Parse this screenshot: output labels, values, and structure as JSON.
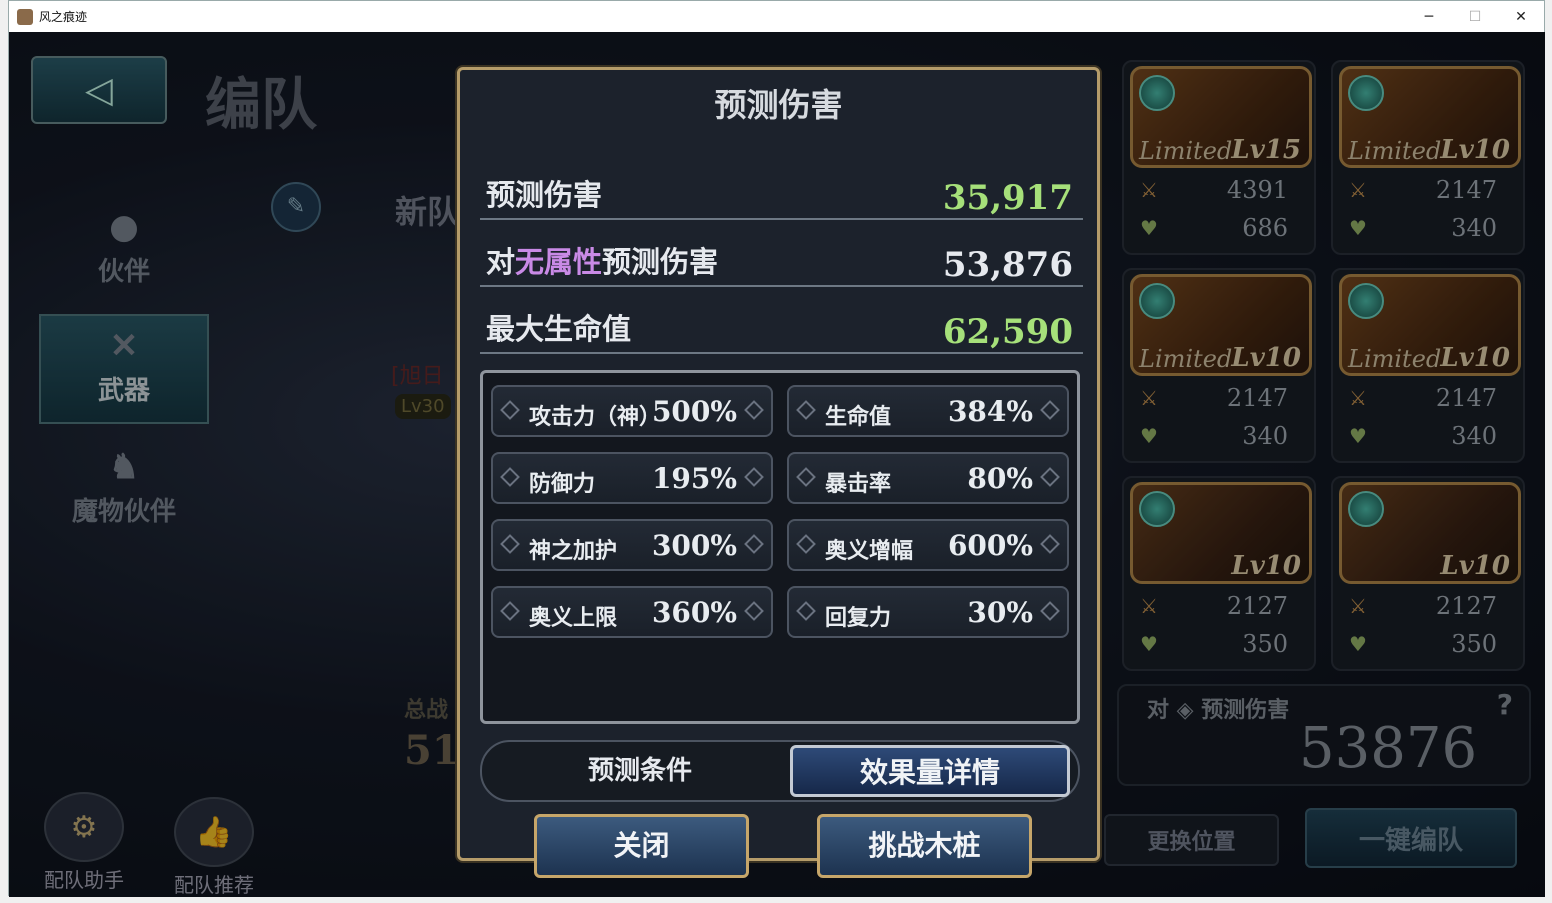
{
  "window": {
    "title": "风之痕迹"
  },
  "left": {
    "formation_title": "编队",
    "menu": [
      {
        "label": "伙伴",
        "icon": "person-icon"
      },
      {
        "label": "武器",
        "icon": "crossed-swords-icon"
      },
      {
        "label": "魔物伙伴",
        "icon": "dragon-icon"
      }
    ],
    "team_new": "新队",
    "team_sub1": "[旭日",
    "team_sub2": "Lv30",
    "total_label": "总战",
    "total_val": "51",
    "tools": [
      {
        "label": "配队助手",
        "icon": "gear-icon"
      },
      {
        "label": "配队推荐",
        "icon": "thumbs-up-icon"
      }
    ]
  },
  "modal": {
    "title": "预测伤害",
    "metrics": [
      {
        "label": "预测伤害",
        "value": "35,917",
        "value_color": "green"
      },
      {
        "label_prefix": "对",
        "label_highlight": "无属性",
        "label_suffix": "预测伤害",
        "value": "53,876",
        "value_color": "white"
      },
      {
        "label": "最大生命值",
        "value": "62,590",
        "value_color": "green"
      }
    ],
    "stats": [
      {
        "label": "攻击力（神）",
        "value": "500%"
      },
      {
        "label": "生命值",
        "value": "384%"
      },
      {
        "label": "防御力",
        "value": "195%"
      },
      {
        "label": "暴击率",
        "value": "80%"
      },
      {
        "label": "神之加护",
        "value": "300%"
      },
      {
        "label": "奥义增幅",
        "value": "600%"
      },
      {
        "label": "奥义上限",
        "value": "360%"
      },
      {
        "label": "回复力",
        "value": "30%"
      }
    ],
    "tabs": {
      "conditions": "预测条件",
      "details": "效果量详情"
    },
    "buttons": {
      "close": "关闭",
      "challenge": "挑战木桩"
    }
  },
  "cards": [
    {
      "limited": "Limited",
      "level": "Lv15",
      "atk": "4391",
      "hp": "686"
    },
    {
      "limited": "Limited",
      "level": "Lv10",
      "atk": "2147",
      "hp": "340"
    },
    {
      "limited": "Limited",
      "level": "Lv10",
      "atk": "2147",
      "hp": "340"
    },
    {
      "limited": "Limited",
      "level": "Lv10",
      "atk": "2147",
      "hp": "340"
    },
    {
      "limited": "",
      "level": "Lv10",
      "atk": "2127",
      "hp": "350"
    },
    {
      "limited": "",
      "level": "Lv10",
      "atk": "2127",
      "hp": "350"
    }
  ],
  "summary": {
    "label": "对 ◈ 预测伤害",
    "question": "?",
    "value": "53876"
  },
  "right_buttons": {
    "swap": "更换位置",
    "auto": "一键编队"
  },
  "colors": {
    "accent_gold": "#b59c6a",
    "green_value": "#a6e07a",
    "purple_attr": "#c98ae6"
  }
}
